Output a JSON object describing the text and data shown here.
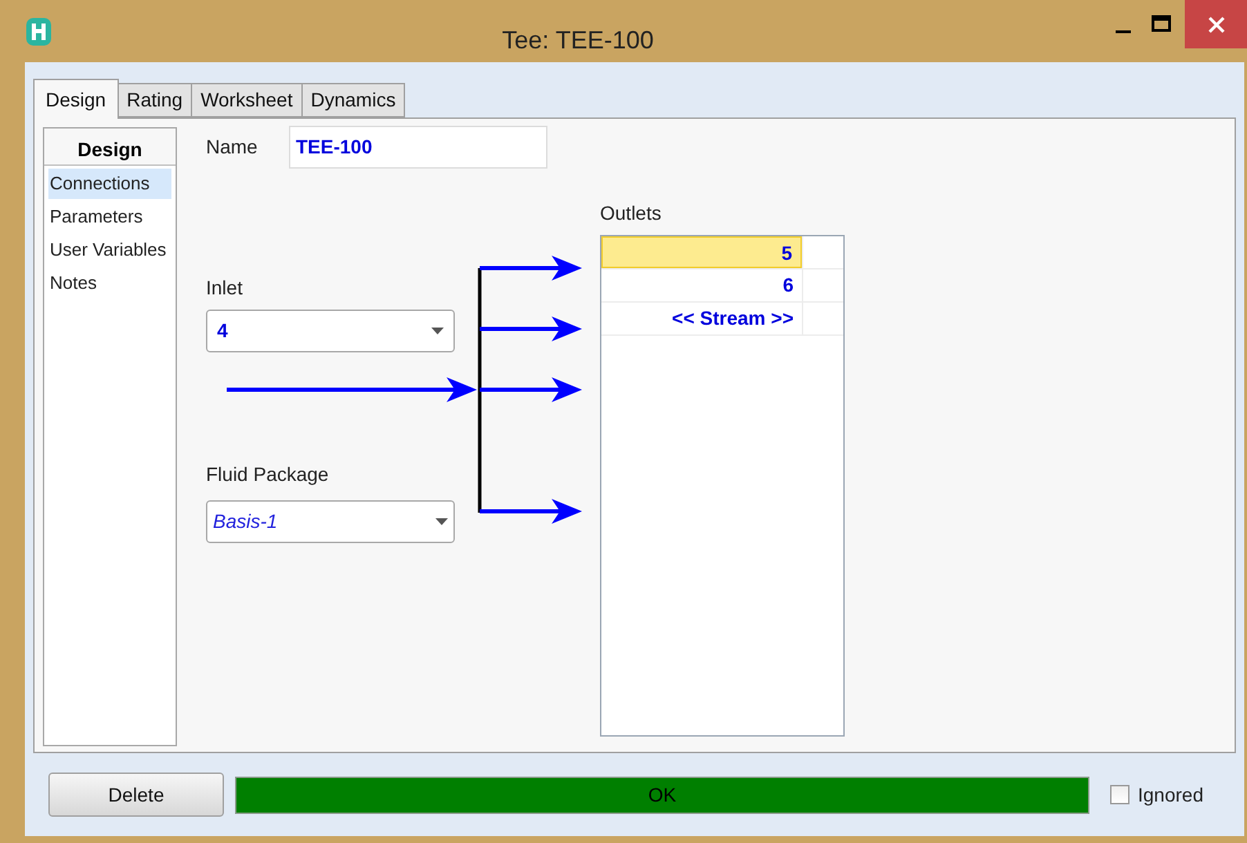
{
  "window": {
    "title": "Tee: TEE-100"
  },
  "tabs": [
    {
      "label": "Design",
      "selected": true
    },
    {
      "label": "Rating",
      "selected": false
    },
    {
      "label": "Worksheet",
      "selected": false
    },
    {
      "label": "Dynamics",
      "selected": false
    }
  ],
  "sidebar": {
    "title": "Design",
    "items": [
      {
        "label": "Connections",
        "selected": true
      },
      {
        "label": "Parameters",
        "selected": false
      },
      {
        "label": "User Variables",
        "selected": false
      },
      {
        "label": "Notes",
        "selected": false
      }
    ]
  },
  "name": {
    "label": "Name",
    "value": "TEE-100"
  },
  "inlet": {
    "label": "Inlet",
    "value": "4"
  },
  "fluid_package": {
    "label": "Fluid Package",
    "value": "Basis-1"
  },
  "outlets": {
    "label": "Outlets",
    "rows": [
      {
        "value": "5",
        "selected": true
      },
      {
        "value": "6",
        "selected": false
      },
      {
        "value": "<< Stream >>",
        "selected": false
      }
    ]
  },
  "footer": {
    "delete": "Delete",
    "status": "OK",
    "ignored": {
      "label": "Ignored",
      "checked": false
    }
  }
}
